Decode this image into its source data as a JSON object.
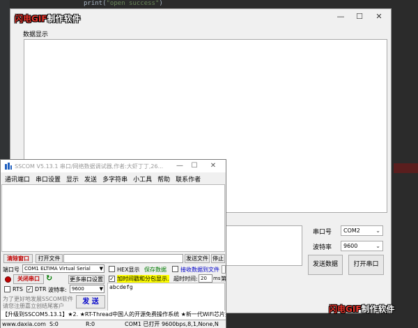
{
  "ide": {
    "code_prefix": "print(",
    "code_string": "\"open success\"",
    "code_suffix": ")"
  },
  "main_window": {
    "title_gif": "闪电GIF",
    "title_rest": "制作软件",
    "minimize": "—",
    "maximize": "☐",
    "close": "✕",
    "display_label": "数据显示",
    "port_label": "串口号",
    "port_value": "COM2",
    "baud_label": "波特率",
    "baud_value": "9600",
    "send_button": "发送数据",
    "open_port_button": "打开串口",
    "watermark_gif": "闪电GIF",
    "watermark_rest": "制作软件"
  },
  "sscom": {
    "title": "SSCOM V5.13.1 串口/网络数据调试器,作者:大虾丁丁,26...",
    "minimize": "—",
    "maximize": "☐",
    "close": "✕",
    "menu": [
      "通讯端口",
      "串口设置",
      "显示",
      "发送",
      "多字符串",
      "小工具",
      "帮助",
      "联系作者"
    ],
    "clear_window": "清除窗口",
    "open_file": "打开文件",
    "send_file": "发送文件",
    "stop": "停止",
    "port_label": "端口号",
    "port_value": "COM1 ELTIMA Virtual Serial",
    "hex_display": "HEX显示",
    "save_data": "保存数据",
    "recv_to_file": "接收数据到文件",
    "close_port": "关闭串口",
    "more_settings": "更多串口设置",
    "add_timestamp": "加时间戳和分包显示.",
    "timeout_label": "超时时间:",
    "timeout_value": "20",
    "timeout_unit": "ms",
    "timeout_more": "第",
    "rts": "RTS",
    "dtr": "DTR",
    "baud_label": "波特率:",
    "baud_value": "9600",
    "send_text": "abcdefg",
    "promo_line1": "为了更好地发展SSCOM软件",
    "promo_line2": "请您注册嘉立创结尾客户",
    "send_button": "发 送",
    "ticker": "【升级到SSCOM5.13.1】★2. ★RT-Thread中国人的开源免费操作系统 ★新一代WiFi芯片兼",
    "status_site": "www.daxia.com",
    "status_s": "S:0",
    "status_r": "R:0",
    "status_port": "COM1 已打开  9600bps,8,1,None,N"
  },
  "colors": {
    "accent_red": "#c00000",
    "highlight": "#ffff00",
    "ide_bg": "#2b2b2b"
  }
}
